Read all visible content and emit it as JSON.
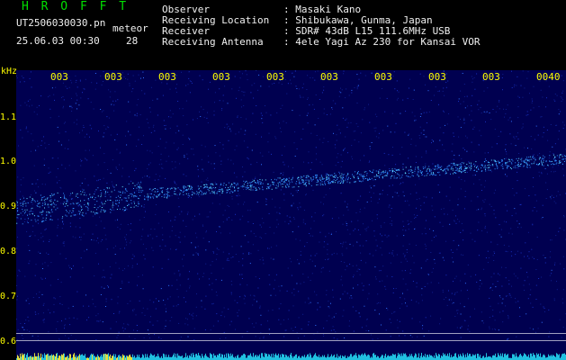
{
  "header": {
    "brand": "H R O F F T",
    "file_name": "UT2506030030.pn",
    "file_type": "meteor",
    "datetime": "25.06.03 00:30",
    "count": "28",
    "fields": [
      {
        "label": "Observer",
        "value": ": Masaki Kano"
      },
      {
        "label": "Receiving Location",
        "value": ": Shibukawa, Gunma, Japan"
      },
      {
        "label": "Receiver",
        "value": ": SDR# 43dB L15 111.6MHz USB"
      },
      {
        "label": "Receiving Antenna",
        "value": ": 4ele Yagi Az 230 for Kansai VOR"
      }
    ]
  },
  "axis": {
    "unit": "kHz",
    "y_ticks": [
      "1.1",
      "1.0",
      "0.9",
      "0.8",
      "0.7",
      "0.6"
    ],
    "x_ticks": [
      "003",
      "003",
      "003",
      "003",
      "003",
      "003",
      "003",
      "003",
      "003",
      "0040"
    ]
  },
  "colors": {
    "background": "#000050",
    "signal": "#40c0ff",
    "label_yellow": "#ffff00",
    "brand_green": "#00e000"
  }
}
